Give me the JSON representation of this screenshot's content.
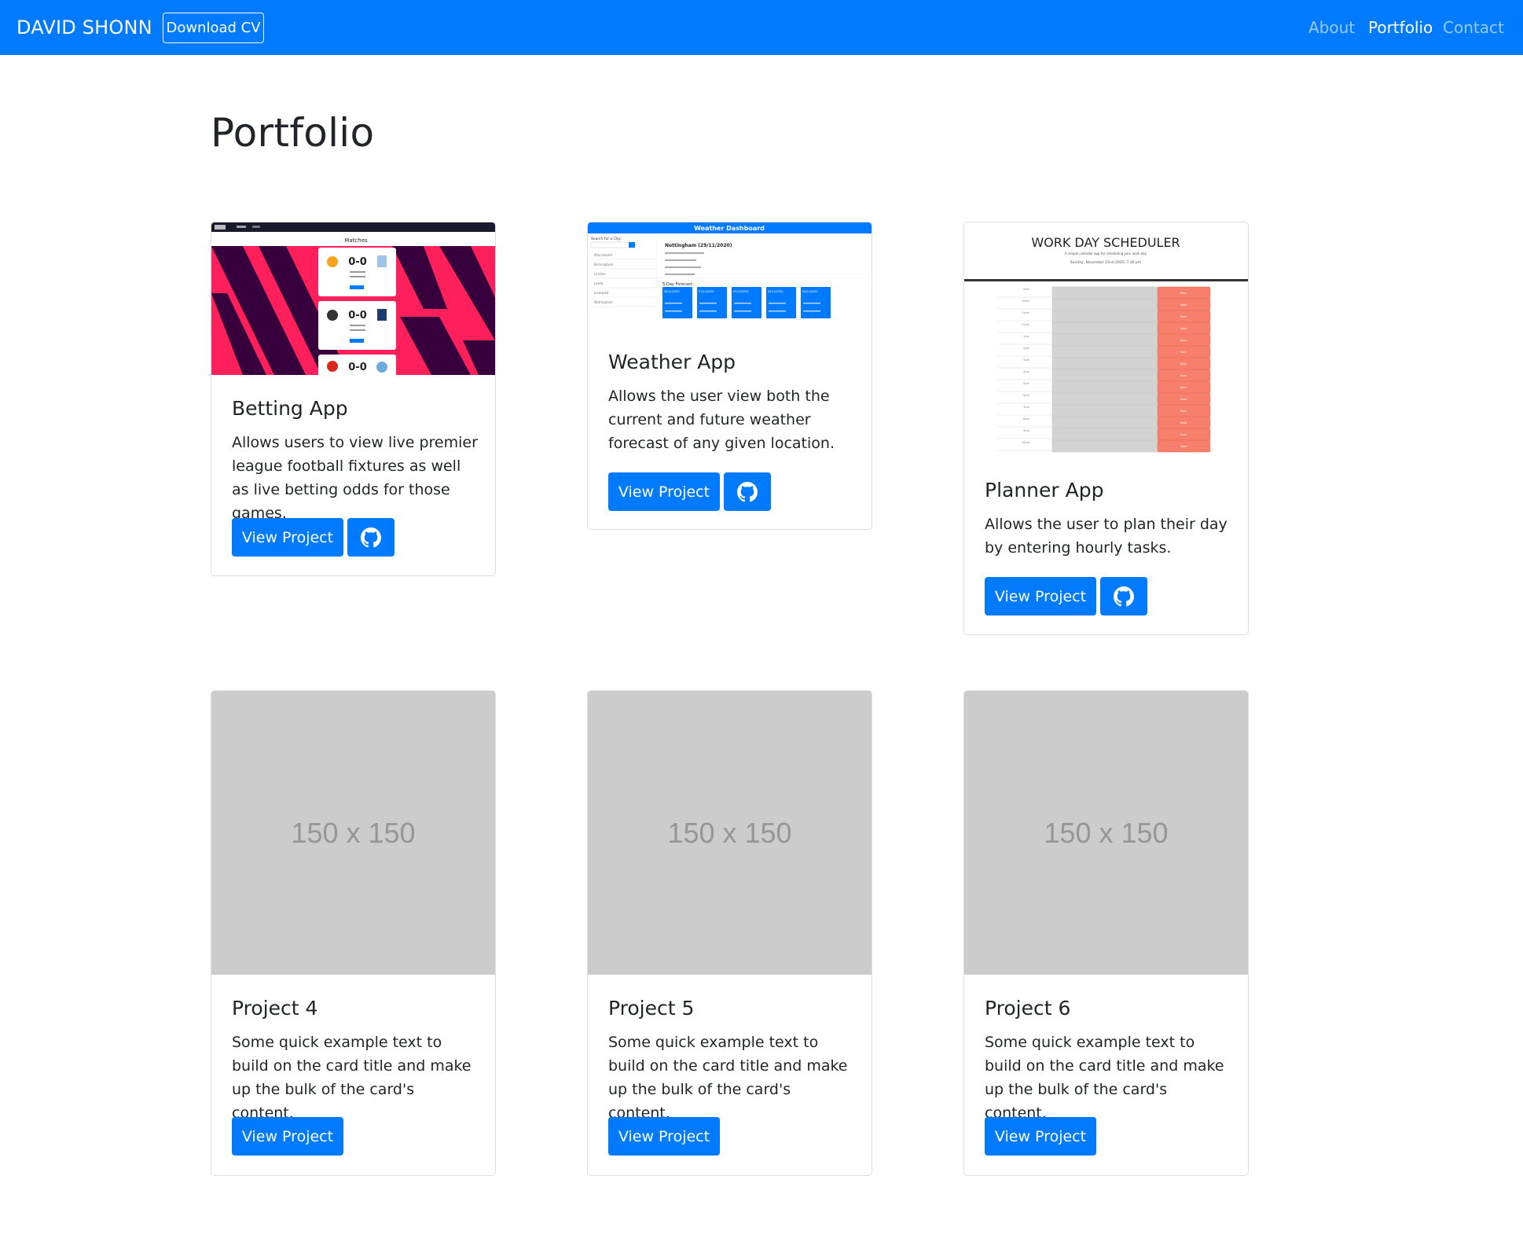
{
  "navbar": {
    "brand": "DAVID SHONN",
    "cv_button": "Download CV",
    "links": [
      "About",
      "Portfolio",
      "Contact"
    ],
    "active": "Portfolio"
  },
  "page": {
    "title": "Portfolio"
  },
  "projects": [
    {
      "title": "Betting App",
      "text": "Allows users to view live premier league football fixtures as well as live betting odds for those games.",
      "button": "View Project",
      "has_github": true,
      "preview": {
        "header": "Matches",
        "scores": [
          "0-0",
          "0-0",
          "0-0"
        ]
      }
    },
    {
      "title": "Weather App",
      "text": "Allows the user view both the current and future weather forecast of any given location.",
      "button": "View Project",
      "has_github": true,
      "preview": {
        "header": "Weather Dashboard",
        "search_label": "Search for a City:",
        "city_line": "Nottingham (29/11/2020)",
        "forecast_label": "5-Day Forecast:",
        "cities": [
          "Manchester",
          "Birmingham",
          "London",
          "Leeds",
          "Liverpool",
          "Nottingham"
        ],
        "days": [
          "30/11/2020",
          "01/12/2020",
          "02/12/2020",
          "03/12/2020",
          "04/12/2020"
        ]
      }
    },
    {
      "title": "Planner App",
      "text": "Allows the user to plan their day by entering hourly tasks.",
      "button": "View Project",
      "has_github": true,
      "preview": {
        "header": "WORK DAY SCHEDULER",
        "subtitle": "A simple calendar app for scheduling your work day",
        "date": "Sunday, November 22nd 2020, 7:30 pm",
        "hours": [
          "9am",
          "10am",
          "11am",
          "12pm",
          "1pm",
          "2pm",
          "3pm",
          "4pm",
          "5pm",
          "6pm",
          "7pm",
          "8pm",
          "9pm",
          "10pm",
          "11pm"
        ],
        "save_label": "Save"
      }
    },
    {
      "title": "Project 4",
      "text": "Some quick example text to build on the card title and make up the bulk of the card's content.",
      "button": "View Project",
      "has_github": false,
      "placeholder": "150 x 150"
    },
    {
      "title": "Project 5",
      "text": "Some quick example text to build on the card title and make up the bulk of the card's content.",
      "button": "View Project",
      "has_github": false,
      "placeholder": "150 x 150"
    },
    {
      "title": "Project 6",
      "text": "Some quick example text to build on the card title and make up the bulk of the card's content.",
      "button": "View Project",
      "has_github": false,
      "placeholder": "150 x 150"
    }
  ],
  "colors": {
    "primary": "#007bff",
    "placeholder_bg": "#cccccc",
    "betting_pink": "#ff1f5a",
    "betting_dark": "#37003c",
    "save_red": "#f77f6b"
  }
}
